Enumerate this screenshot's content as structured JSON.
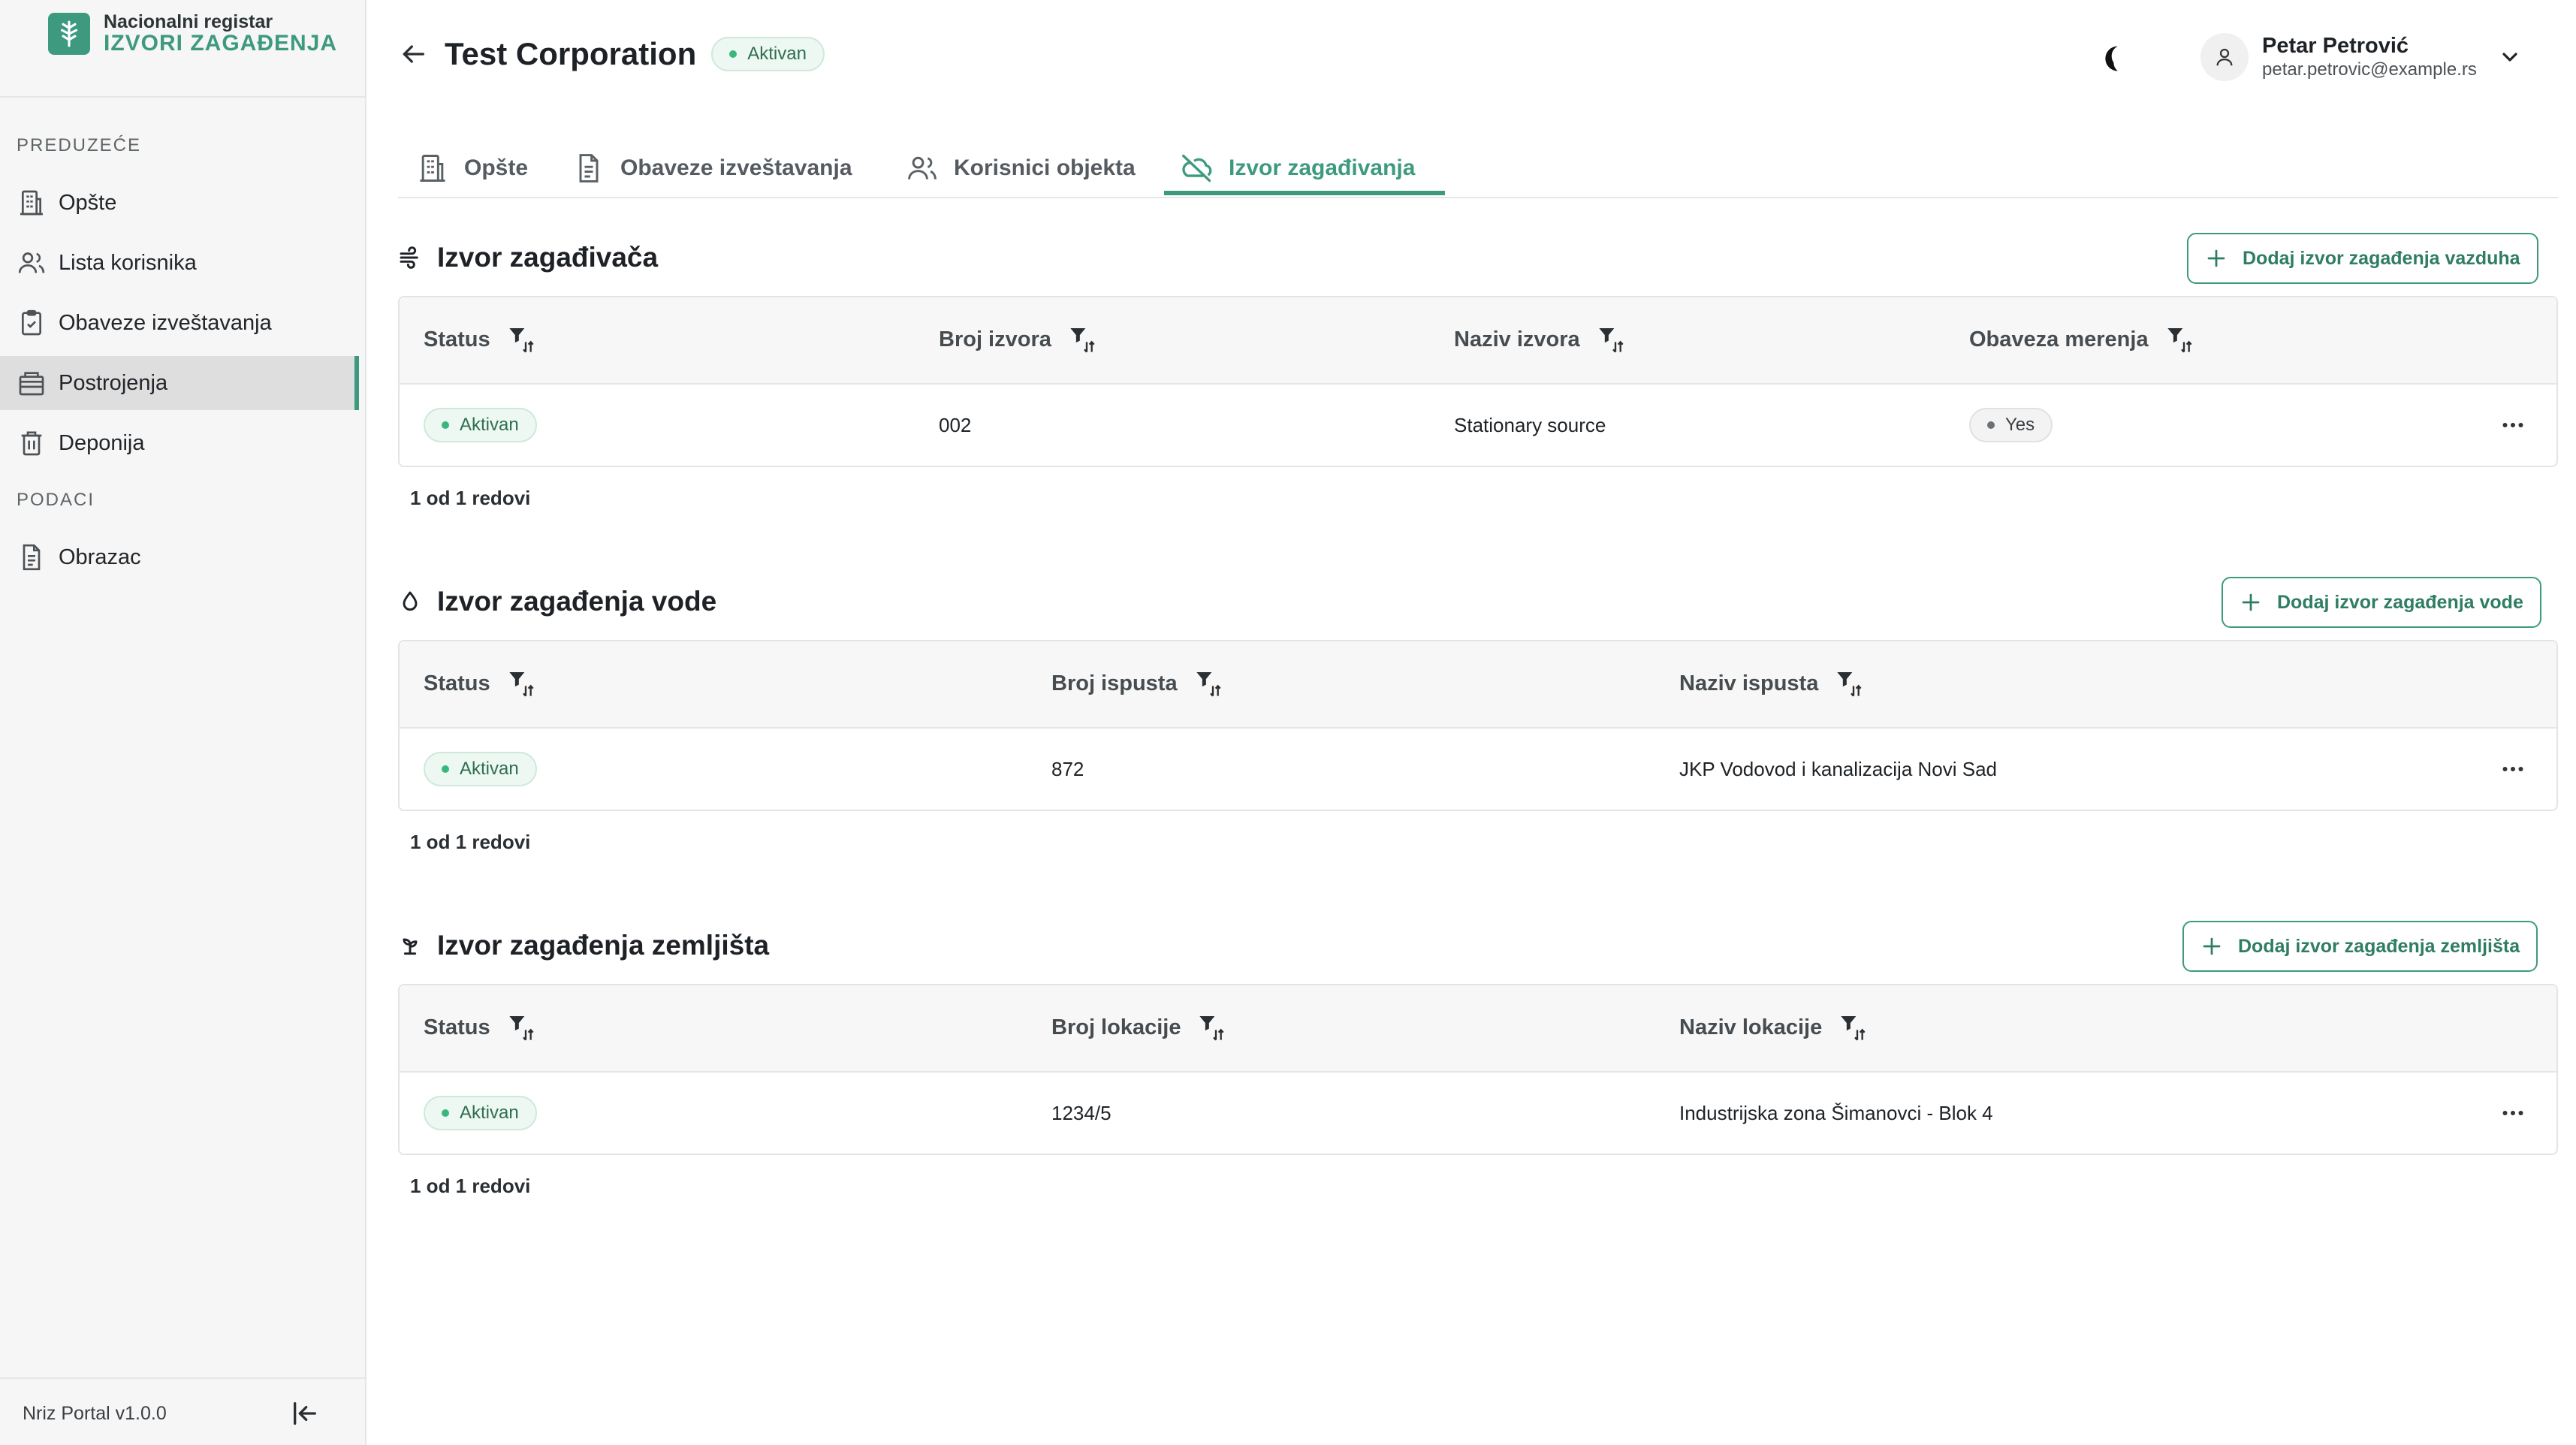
{
  "sidebar": {
    "brand": {
      "line1": "Nacionalni registar",
      "line2": "IZVORI ZAGAĐENJA"
    },
    "sections": [
      {
        "label": "PREDUZEĆE",
        "items": [
          {
            "label": "Opšte",
            "icon": "building-icon"
          },
          {
            "label": "Lista korisnika",
            "icon": "users-icon"
          },
          {
            "label": "Obaveze izveštavanja",
            "icon": "clipboard-check-icon"
          },
          {
            "label": "Postrojenja",
            "icon": "factory-icon",
            "active": true
          },
          {
            "label": "Deponija",
            "icon": "trash-icon"
          }
        ]
      },
      {
        "label": "PODACI",
        "items": [
          {
            "label": "Obrazac",
            "icon": "document-icon"
          }
        ]
      }
    ],
    "version": "Nriz Portal v1.0.0"
  },
  "header": {
    "title": "Test Corporation",
    "status": "Aktivan",
    "user": {
      "name": "Petar Petrović",
      "email": "petar.petrovic@example.rs"
    }
  },
  "tabs": [
    {
      "label": "Opšte",
      "icon": "building-icon"
    },
    {
      "label": "Obaveze izveštavanja",
      "icon": "document-icon"
    },
    {
      "label": "Korisnici objekta",
      "icon": "users-icon"
    },
    {
      "label": "Izvor zagađivanja",
      "icon": "cloud-off-icon",
      "active": true
    }
  ],
  "sections": {
    "air": {
      "title": "Izvor zagađivača",
      "add_label": "Dodaj izvor zagađenja vazduha",
      "columns": [
        "Status",
        "Broj izvora",
        "Naziv izvora",
        "Obaveza merenja"
      ],
      "rows": [
        {
          "status": "Aktivan",
          "number": "002",
          "name": "Stationary source",
          "measurement": "Yes"
        }
      ],
      "count": "1 od 1 redovi"
    },
    "water": {
      "title": "Izvor zagađenja vode",
      "add_label": "Dodaj izvor zagađenja vode",
      "columns": [
        "Status",
        "Broj ispusta",
        "Naziv ispusta"
      ],
      "rows": [
        {
          "status": "Aktivan",
          "number": "872",
          "name": "JKP Vodovod i kanalizacija Novi Sad"
        }
      ],
      "count": "1 od 1 redovi"
    },
    "soil": {
      "title": "Izvor zagađenja zemljišta",
      "add_label": "Dodaj izvor zagađenja zemljišta",
      "columns": [
        "Status",
        "Broj lokacije",
        "Naziv lokacije"
      ],
      "rows": [
        {
          "status": "Aktivan",
          "number": "1234/5",
          "name": "Industrijska zona Šimanovci - Blok 4"
        }
      ],
      "count": "1 od 1 redovi"
    }
  },
  "colors": {
    "accent": "#3e9a7f",
    "active_dot": "#3bb77e"
  }
}
